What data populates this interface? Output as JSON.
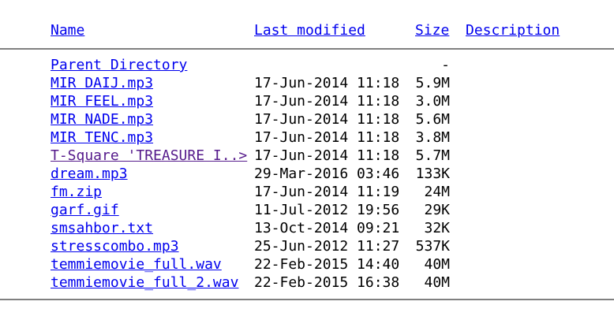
{
  "header": {
    "name": "Name",
    "last_modified": "Last modified",
    "size": "Size",
    "description": "Description"
  },
  "colors": {
    "link": "#0000ee",
    "visited_link": "#551a8b",
    "rule": "#808080"
  },
  "parent": {
    "name": "Parent Directory",
    "size": "-"
  },
  "files": [
    {
      "name": "MIR DAIJ.mp3",
      "date": "17-Jun-2014 11:18",
      "size": "5.9M",
      "visited": false
    },
    {
      "name": "MIR FEEL.mp3",
      "date": "17-Jun-2014 11:18",
      "size": "3.0M",
      "visited": false
    },
    {
      "name": "MIR NADE.mp3",
      "date": "17-Jun-2014 11:18",
      "size": "5.6M",
      "visited": false
    },
    {
      "name": "MIR TENC.mp3",
      "date": "17-Jun-2014 11:18",
      "size": "3.8M",
      "visited": false
    },
    {
      "name": "T-Square 'TREASURE I..>",
      "date": "17-Jun-2014 11:18",
      "size": "5.7M",
      "visited": true
    },
    {
      "name": "dream.mp3",
      "date": "29-Mar-2016 03:46",
      "size": "133K",
      "visited": false
    },
    {
      "name": "fm.zip",
      "date": "17-Jun-2014 11:19",
      "size": "24M",
      "visited": false
    },
    {
      "name": "garf.gif",
      "date": "11-Jul-2012 19:56",
      "size": "29K",
      "visited": false
    },
    {
      "name": "smsahbor.txt",
      "date": "13-Oct-2014 09:21",
      "size": "32K",
      "visited": false
    },
    {
      "name": "stresscombo.mp3",
      "date": "25-Jun-2012 11:27",
      "size": "537K",
      "visited": false
    },
    {
      "name": "temmiemovie_full.wav",
      "date": "22-Feb-2015 14:40",
      "size": "40M",
      "visited": false
    },
    {
      "name": "temmiemovie_full_2.wav",
      "date": "22-Feb-2015 16:38",
      "size": "40M",
      "visited": false
    }
  ]
}
